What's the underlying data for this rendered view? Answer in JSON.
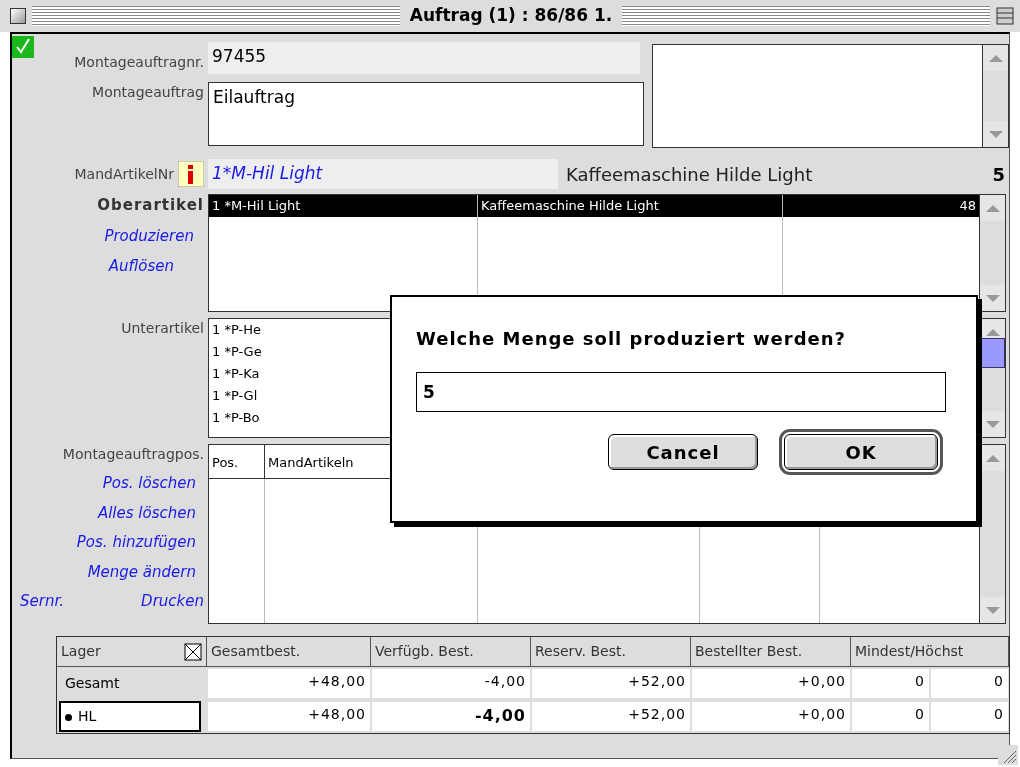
{
  "window": {
    "title": "Auftrag (1) : 86/86 1."
  },
  "header": {
    "checked": true,
    "order_no_label": "Montageauftragnr.",
    "order_no": "97455",
    "order_label": "Montageauftrag",
    "order": "Eilauftrag",
    "article_label": "MandArtikelNr",
    "article_no": "1*M-Hil Light",
    "article_name": "Kaffeemaschine Hilde Light",
    "quantity": "5"
  },
  "parent_articles": {
    "label": "Oberartikel",
    "actions": [
      "Produzieren",
      "Auflösen"
    ],
    "rows": [
      {
        "cells": [
          "1 *M-Hil Light",
          "Kaffeemaschine Hilde Light",
          "48"
        ],
        "selected": true
      }
    ]
  },
  "sub_articles": {
    "label": "Unterartikel",
    "items": [
      "1 *P-He",
      "1 *P-Ge",
      "1 *P-Ka",
      "1 *P-Gl",
      "1 *P-Bo"
    ]
  },
  "positions": {
    "label": "Montageauftragpos.",
    "columns": [
      "Pos.",
      "MandArtikeln"
    ],
    "actions": [
      "Pos. löschen",
      "Alles löschen",
      "Pos. hinzufügen",
      "Menge ändern",
      "Drucken"
    ],
    "side_action": "Sernr."
  },
  "stock": {
    "all_checked": true,
    "columns": [
      "Lager",
      "Gesamtbest.",
      "Verfügb. Best.",
      "Reserv. Best.",
      "Bestellter Best.",
      "Mindest/Höchst"
    ],
    "rows": [
      {
        "name": "Gesamt",
        "selected": false,
        "cells": [
          {
            "text": "+48,00",
            "bold": false
          },
          {
            "text": "-4,00",
            "bold": false
          },
          {
            "text": "+52,00",
            "bold": false
          },
          {
            "text": "+0,00",
            "bold": false
          },
          {
            "bold": false,
            "min": "0",
            "max": "0"
          }
        ]
      },
      {
        "name": "HL",
        "selected": true,
        "cells": [
          {
            "text": "+48,00",
            "bold": false
          },
          {
            "text": "-4,00",
            "bold": true
          },
          {
            "text": "+52,00",
            "bold": false
          },
          {
            "text": "+0,00",
            "bold": false
          },
          {
            "bold": false,
            "min": "0",
            "max": "0"
          }
        ]
      }
    ]
  },
  "dialog": {
    "prompt": "Welche Menge soll produziert werden?",
    "value": "5",
    "buttons": [
      {
        "label": "Cancel",
        "default": false
      },
      {
        "label": "OK",
        "default": true
      }
    ]
  }
}
